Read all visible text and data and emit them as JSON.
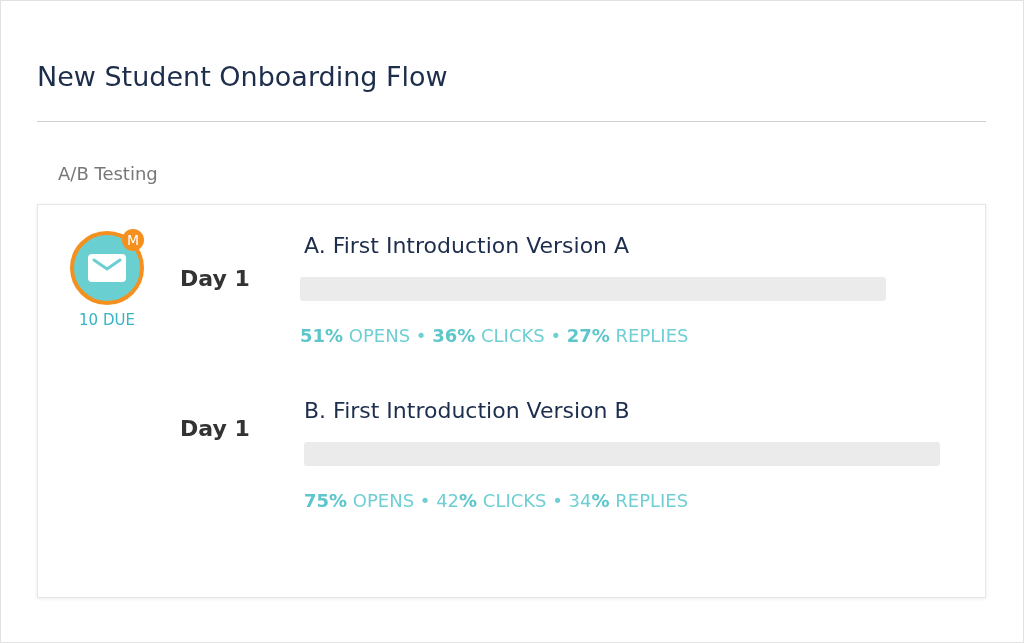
{
  "title": "New Student Onboarding Flow",
  "section": {
    "label": "A/B Testing"
  },
  "steps": [
    {
      "channel": {
        "kind": "email",
        "badge": "M",
        "due": "10 DUE"
      },
      "day": "Day 1",
      "name": "A. First Introduction Version A",
      "stats": "**51%** OPENS • **36%** CLICKS • **27%** REPLIES"
    },
    {
      "day": "Day 1",
      "name": "B. First Introduction Version B",
      "stats": "**75%** OPENS • 42**%** CLICKS • 34**%** REPLIES"
    }
  ]
}
